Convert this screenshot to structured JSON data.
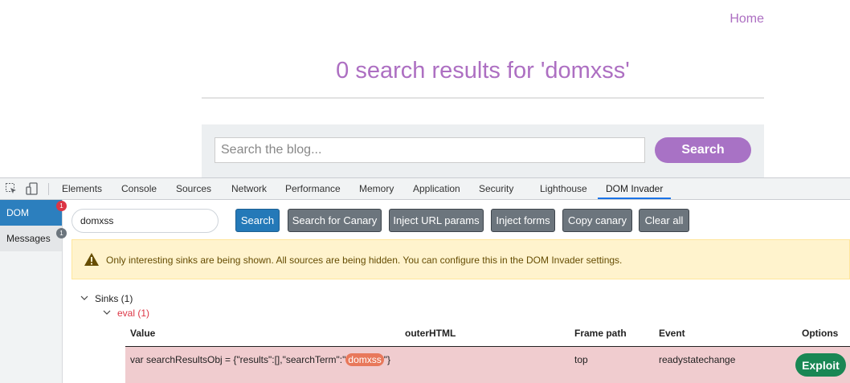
{
  "site": {
    "home_link": "Home",
    "page_title": "0 search results for 'domxss'",
    "search_placeholder": "Search the blog...",
    "search_button": "Search"
  },
  "devtools": {
    "tabs": [
      "Elements",
      "Console",
      "Sources",
      "Network",
      "Performance",
      "Memory",
      "Application",
      "Security",
      "Lighthouse",
      "DOM Invader"
    ],
    "active_tab": "DOM Invader",
    "icons": [
      "inspect-element-icon",
      "device-toggle-icon"
    ]
  },
  "dom_invader": {
    "sidebar": [
      {
        "label": "DOM",
        "badge": "1",
        "active": true
      },
      {
        "label": "Messages",
        "badge": "1",
        "active": false
      }
    ],
    "canary_value": "domxss",
    "buttons": {
      "search": "Search",
      "search_canary": "Search for Canary",
      "inject_url": "Inject URL params",
      "inject_forms": "Inject forms",
      "copy_canary": "Copy canary",
      "clear_all": "Clear all"
    },
    "warning": "Only interesting sinks are being shown. All sources are being hidden. You can configure this in the DOM Invader settings.",
    "tree": {
      "sinks_label": "Sinks (1)",
      "eval_label": "eval (1)"
    },
    "table": {
      "headers": [
        "Value",
        "outerHTML",
        "Frame path",
        "Event",
        "Options"
      ],
      "row": {
        "value_prefix": "var searchResultsObj = {\"results\":[],\"searchTerm\":\"",
        "value_canary": "domxss",
        "value_suffix": "\"}",
        "outer_html": "",
        "frame_path": "top",
        "event": "readystatechange",
        "option_button": "Exploit"
      }
    }
  },
  "colors": {
    "accent_purple": "#ad6fc2",
    "devtools_active_blue": "#2c7fbe",
    "sink_row_bg": "#f0cccf",
    "exploit_green": "#198754"
  }
}
